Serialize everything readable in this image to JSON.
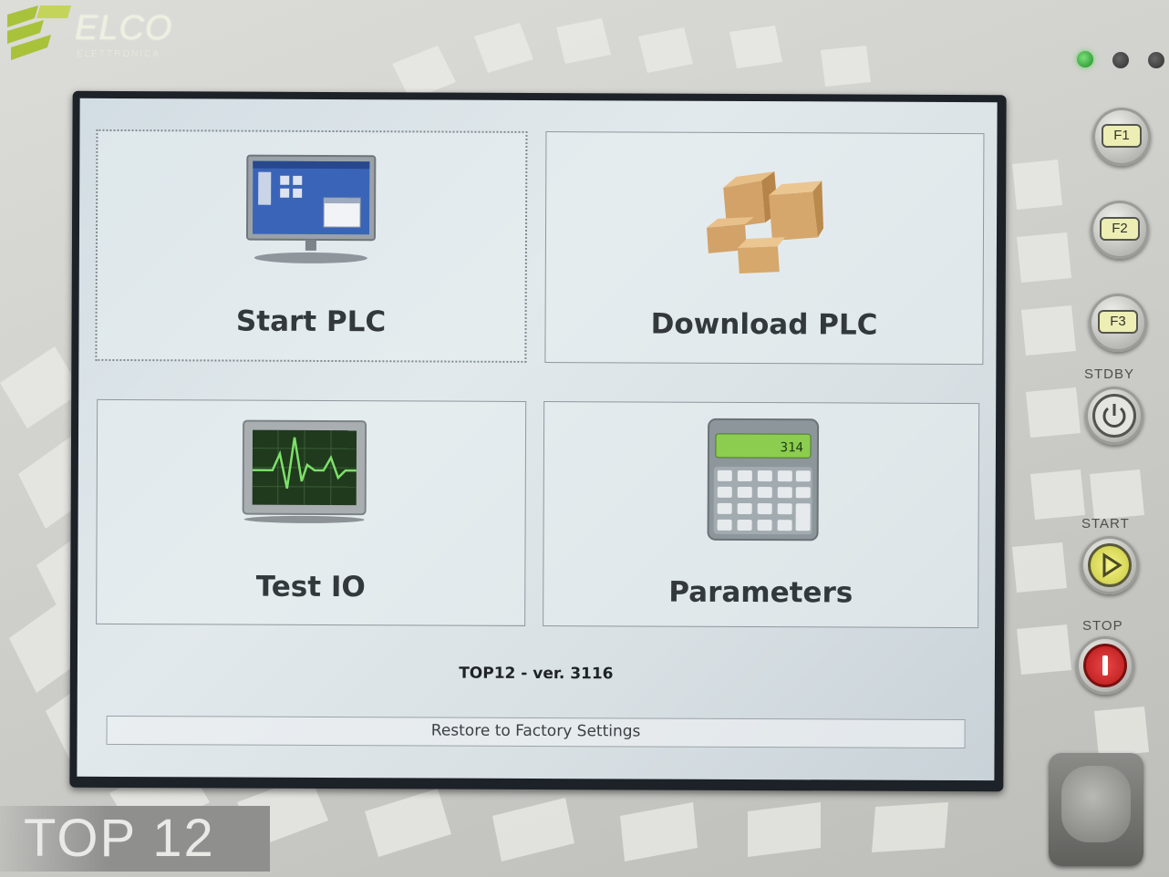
{
  "device": {
    "brand": "ELCO",
    "brand_sub": "ELETTRONICA",
    "model_label": "TOP 12",
    "hardware_buttons": {
      "f1": "F1",
      "f2": "F2",
      "f3": "F3",
      "stdby": "STDBY",
      "start": "START",
      "stop": "STOP"
    },
    "leds": [
      {
        "name": "led-1",
        "color": "#4fc94f",
        "state": "on"
      },
      {
        "name": "led-2",
        "color": "#3a3a3a",
        "state": "off"
      },
      {
        "name": "led-3",
        "color": "#3a3a3a",
        "state": "off"
      }
    ]
  },
  "screen": {
    "tiles": [
      {
        "label": "Start PLC",
        "icon": "monitor-desktop-icon"
      },
      {
        "label": "Download PLC",
        "icon": "boxes-icon"
      },
      {
        "label": "Test IO",
        "icon": "oscilloscope-icon"
      },
      {
        "label": "Parameters",
        "icon": "calculator-icon"
      }
    ],
    "calculator_display": "314",
    "version": "TOP12 - ver. 3116",
    "factory_button": "Restore to Factory Settings"
  },
  "colors": {
    "accent_green": "#a8c23a",
    "stop_red": "#c81e1e",
    "start_yellow": "#e4e46a"
  }
}
